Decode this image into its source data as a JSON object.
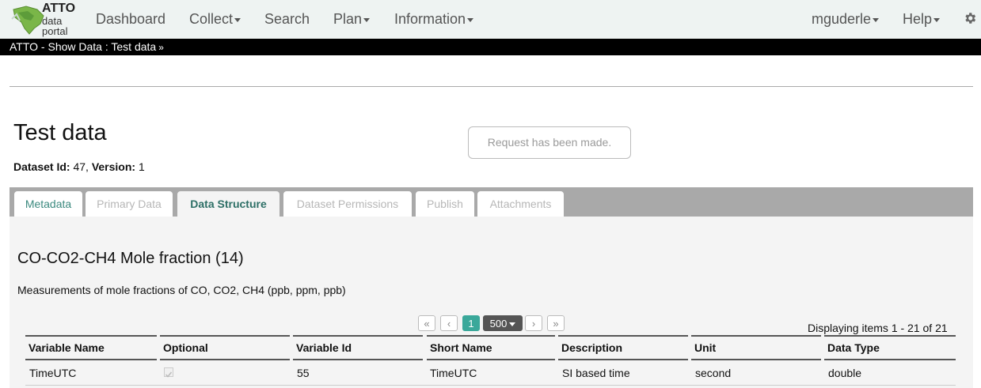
{
  "brand": {
    "line1": "ATTO",
    "line2": "data",
    "line3": "portal"
  },
  "nav": {
    "dashboard": "Dashboard",
    "collect": "Collect",
    "search": "Search",
    "plan": "Plan",
    "information": "Information",
    "user": "mguderle",
    "help": "Help"
  },
  "breadcrumb": "ATTO - Show Data : Test data",
  "page": {
    "title": "Test data",
    "dataset_id_label": "Dataset Id:",
    "dataset_id": "47",
    "version_label": "Version:",
    "version": "1",
    "request_button": "Request has been made."
  },
  "tabs": [
    {
      "label": "Metadata"
    },
    {
      "label": "Primary Data"
    },
    {
      "label": "Data Structure"
    },
    {
      "label": "Dataset Permissions"
    },
    {
      "label": "Publish"
    },
    {
      "label": "Attachments"
    }
  ],
  "structure": {
    "title": "CO-CO2-CH4 Mole fraction (14)",
    "description": "Measurements of mole fractions of CO, CO2, CH4 (ppb, ppm, ppb)"
  },
  "pager": {
    "first": "«",
    "prev": "‹",
    "current_page": "1",
    "page_size": "500",
    "next": "›",
    "last": "»",
    "info": "Displaying items 1 - 21 of 21"
  },
  "table": {
    "headers": [
      "Variable Name",
      "Optional",
      "Variable Id",
      "Short Name",
      "Description",
      "Unit",
      "Data Type"
    ],
    "rows": [
      {
        "variable_name": "TimeUTC",
        "optional": true,
        "variable_id": "55",
        "short_name": "TimeUTC",
        "description": "SI based time",
        "unit": "second",
        "data_type": "double"
      }
    ]
  },
  "colors": {
    "accent": "#3aa89a",
    "nav_bg": "#eef3f2",
    "tab_link": "#3c8a7f"
  }
}
